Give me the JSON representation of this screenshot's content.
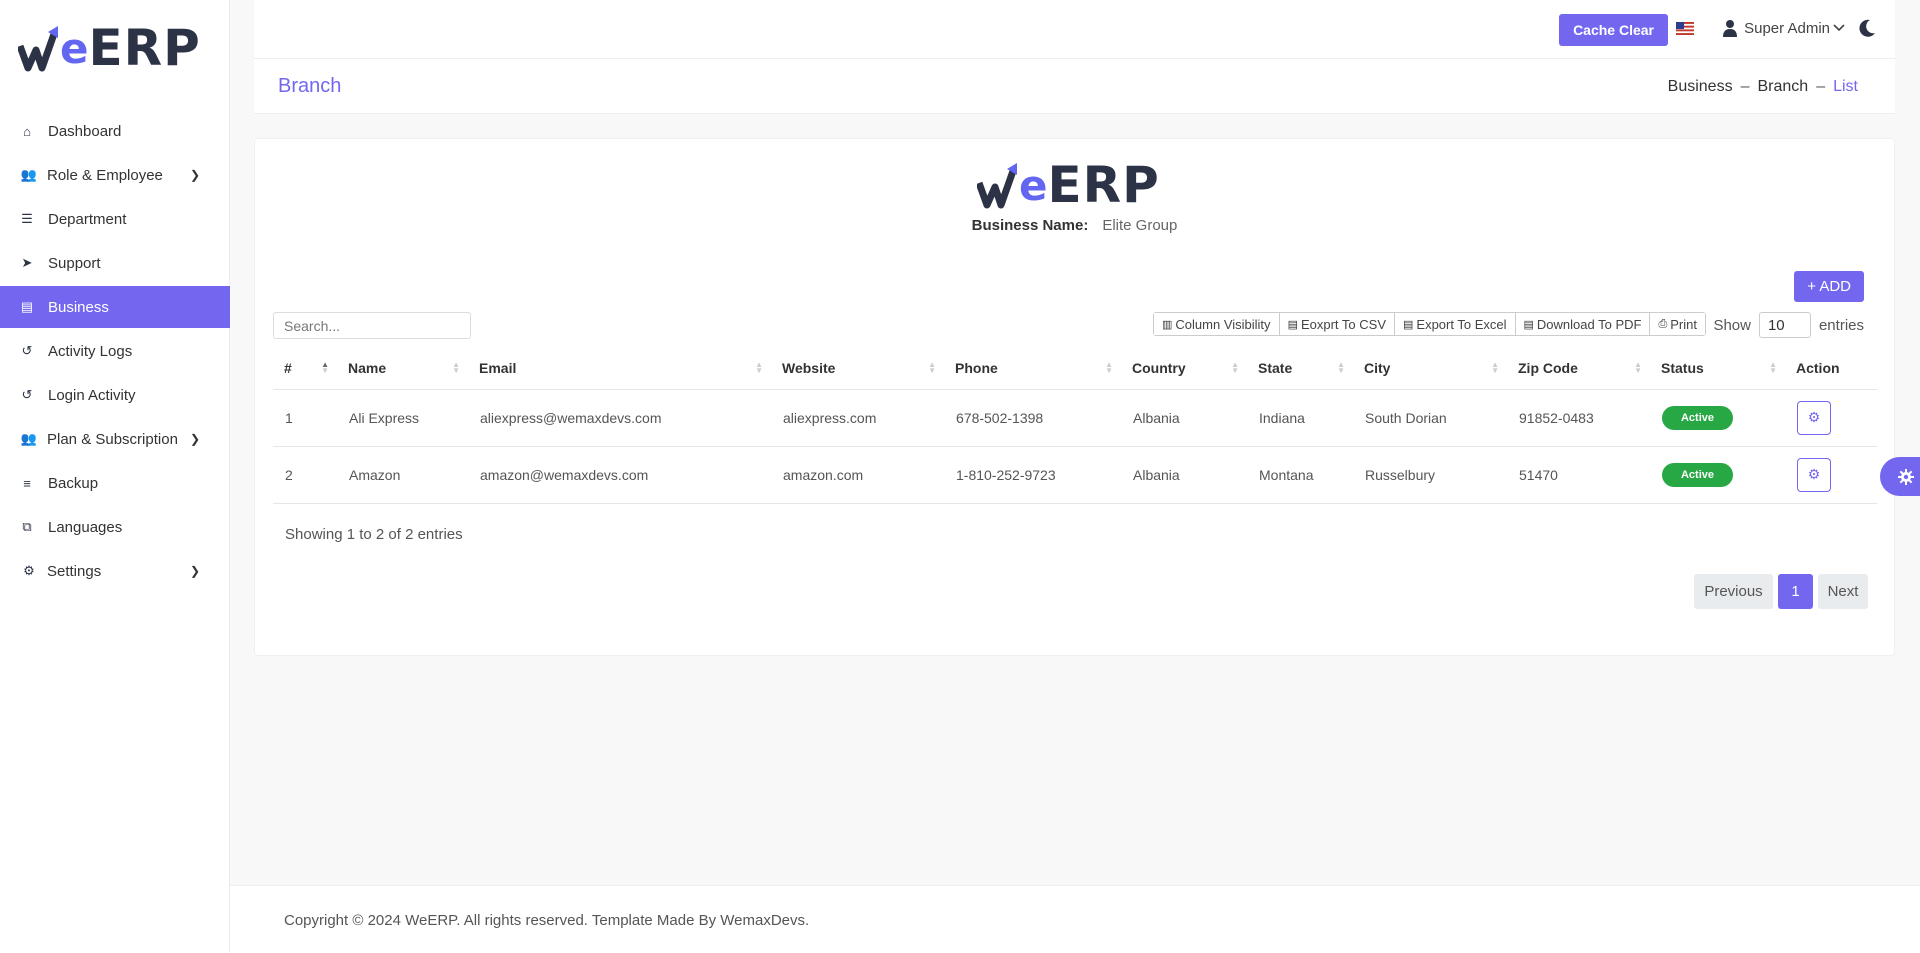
{
  "brand": {
    "logo_letter": "e",
    "logo_text": "ERP",
    "accent": "#7367f0"
  },
  "sidebar": {
    "items": [
      {
        "label": "Dashboard",
        "icon": "home-icon",
        "glyph": "⌂"
      },
      {
        "label": "Role & Employee",
        "icon": "users-icon",
        "glyph": "👥"
      },
      {
        "label": "Department",
        "icon": "list-icon",
        "glyph": "☰"
      },
      {
        "label": "Support",
        "icon": "paper-plane-icon",
        "glyph": "➤"
      },
      {
        "label": "Business",
        "icon": "document-icon",
        "glyph": "▤"
      },
      {
        "label": "Activity Logs",
        "icon": "history-icon",
        "glyph": "↺"
      },
      {
        "label": "Login Activity",
        "icon": "history-icon",
        "glyph": "↺"
      },
      {
        "label": "Plan & Subscription",
        "icon": "users-icon",
        "glyph": "👥"
      },
      {
        "label": "Backup",
        "icon": "database-icon",
        "glyph": "≡"
      },
      {
        "label": "Languages",
        "icon": "language-icon",
        "glyph": "⧉"
      },
      {
        "label": "Settings",
        "icon": "gears-icon",
        "glyph": "⚙"
      }
    ]
  },
  "header": {
    "cache_clear": "Cache Clear",
    "user_name": "Super Admin"
  },
  "subheader": {
    "title": "Branch",
    "breadcrumb": [
      "Business",
      "Branch",
      "List"
    ],
    "sep": "–"
  },
  "card": {
    "business_label": "Business Name:",
    "business_value": "Elite Group",
    "add_button": "+ ADD",
    "search_placeholder": "Search...",
    "tools": {
      "column_visibility": "Column Visibility",
      "export_csv": "Eoxprt To CSV",
      "export_excel": "Export To Excel",
      "download_pdf": "Download To PDF",
      "print": "Print"
    },
    "show_label": "Show",
    "page_size": "10",
    "entries_label": "entries"
  },
  "table": {
    "headers": [
      "#",
      "Name",
      "Email",
      "Website",
      "Phone",
      "Country",
      "State",
      "City",
      "Zip Code",
      "Status",
      "Action"
    ],
    "rows": [
      {
        "num": "1",
        "name": "Ali Express",
        "email": "aliexpress@wemaxdevs.com",
        "website": "aliexpress.com",
        "phone": "678-502-1398",
        "country": "Albania",
        "state": "Indiana",
        "city": "South Dorian",
        "zip": "91852-0483",
        "status": "Active"
      },
      {
        "num": "2",
        "name": "Amazon",
        "email": "amazon@wemaxdevs.com",
        "website": "amazon.com",
        "phone": "1-810-252-9723",
        "country": "Albania",
        "state": "Montana",
        "city": "Russelbury",
        "zip": "51470",
        "status": "Active"
      }
    ]
  },
  "pagination": {
    "info": "Showing 1 to 2 of 2 entries",
    "previous": "Previous",
    "current": "1",
    "next": "Next"
  },
  "footer": {
    "copyright": "Copyright © 2024 WeERP. All rights reserved. Template Made By WemaxDevs."
  }
}
